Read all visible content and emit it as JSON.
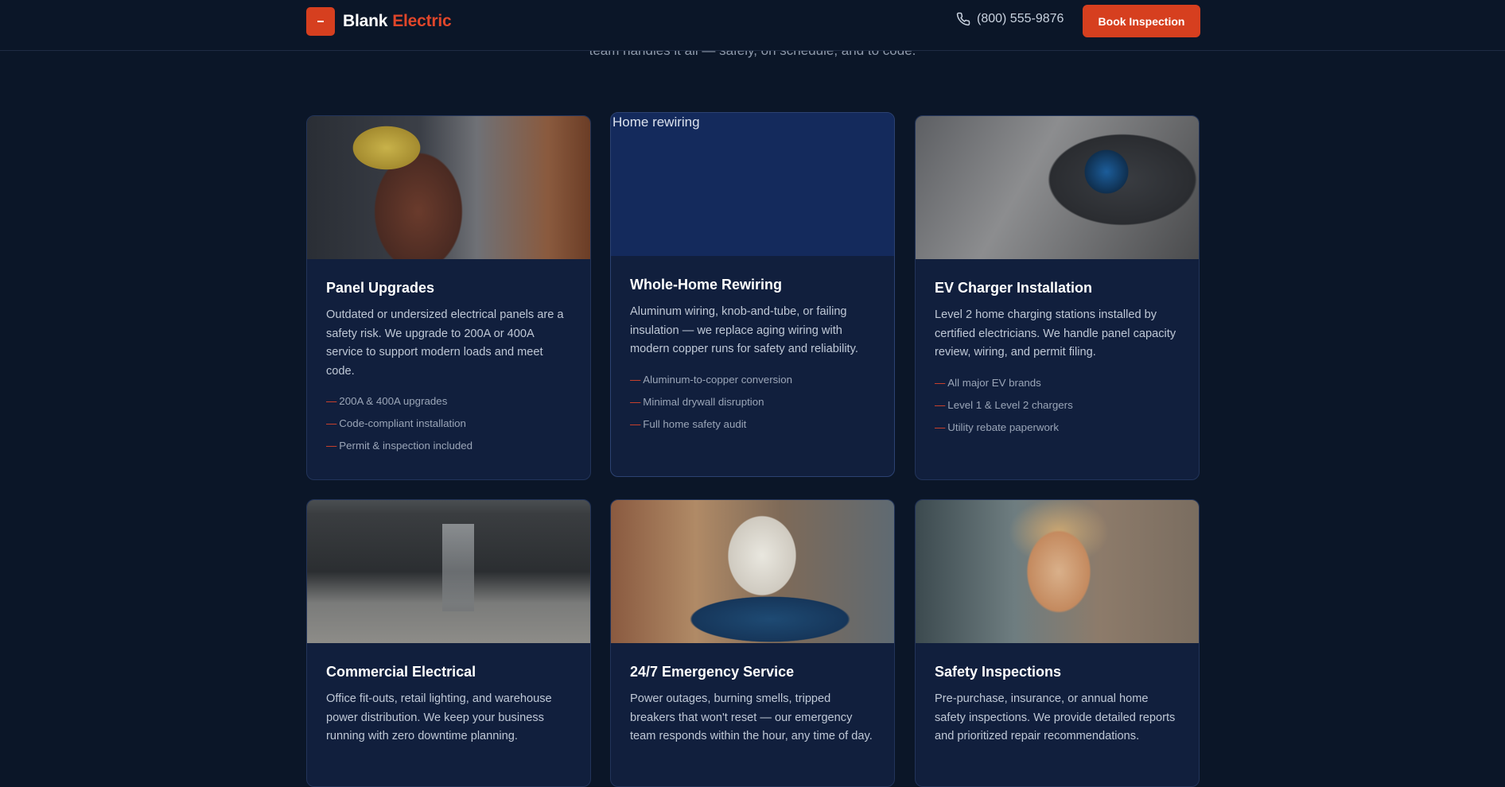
{
  "header": {
    "logo_word1": "Blank",
    "logo_word2": "Electric",
    "phone": "(800) 555-9876",
    "cta_label": "Book Inspection"
  },
  "intro_text": "team handles it all — safely, on schedule, and to code.",
  "services": [
    {
      "title": "Panel Upgrades",
      "description": "Outdated or undersized electrical panels are a safety risk. We upgrade to 200A or 400A service to support modern loads and meet code.",
      "features": [
        "200A & 400A upgrades",
        "Code-compliant installation",
        "Permit & inspection included"
      ]
    },
    {
      "title": "Whole-Home Rewiring",
      "image_alt": "Home rewiring",
      "description": "Aluminum wiring, knob-and-tube, or failing insulation — we replace aging wiring with modern copper runs for safety and reliability.",
      "features": [
        "Aluminum-to-copper conversion",
        "Minimal drywall disruption",
        "Full home safety audit"
      ]
    },
    {
      "title": "EV Charger Installation",
      "description": "Level 2 home charging stations installed by certified electricians. We handle panel capacity review, wiring, and permit filing.",
      "features": [
        "All major EV brands",
        "Level 1 & Level 2 chargers",
        "Utility rebate paperwork"
      ]
    },
    {
      "title": "Commercial Electrical",
      "description": "Office fit-outs, retail lighting, and warehouse power distribution. We keep your business running with zero downtime planning."
    },
    {
      "title": "24/7 Emergency Service",
      "description": "Power outages, burning smells, tripped breakers that won't reset — our emergency team responds within the hour, any time of day."
    },
    {
      "title": "Safety Inspections",
      "description": "Pre-purchase, insurance, or annual home safety inspections. We provide detailed reports and prioritized repair recommendations."
    }
  ]
}
